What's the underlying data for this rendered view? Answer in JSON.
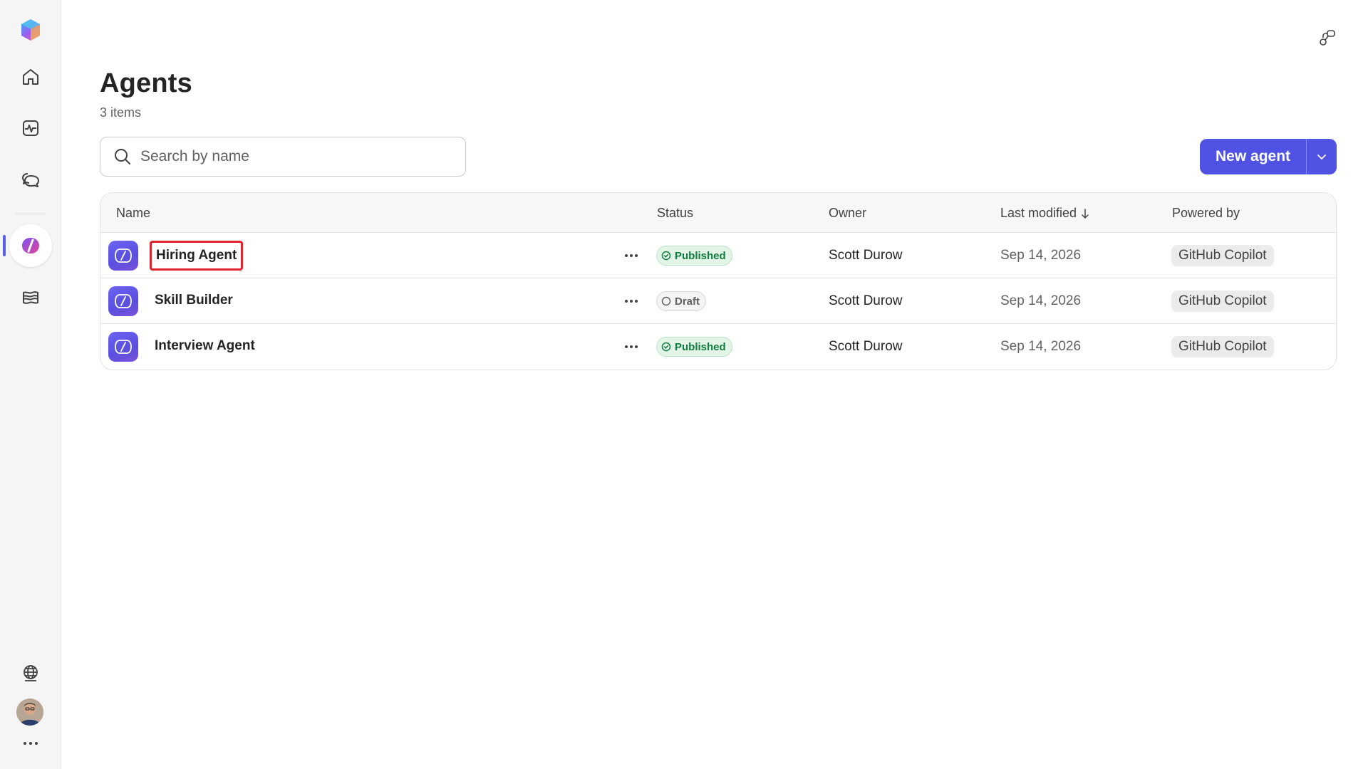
{
  "rail": {
    "items": [
      {
        "name": "home",
        "icon": "home-icon"
      },
      {
        "name": "activity",
        "icon": "activity-icon"
      },
      {
        "name": "chat",
        "icon": "chat-icon"
      },
      {
        "name": "agents",
        "icon": "agent-studio-icon",
        "active": true
      },
      {
        "name": "library",
        "icon": "library-icon"
      }
    ],
    "bottom": [
      {
        "name": "globe",
        "icon": "globe-icon"
      },
      {
        "name": "avatar",
        "icon": "avatar"
      },
      {
        "name": "more",
        "icon": "more-horizontal-icon"
      }
    ]
  },
  "page": {
    "title": "Agents",
    "count": "3 items"
  },
  "search": {
    "placeholder": "Search by name"
  },
  "toolbar": {
    "new_agent_label": "New agent"
  },
  "table": {
    "columns": {
      "name": "Name",
      "status": "Status",
      "owner": "Owner",
      "modified": "Last modified",
      "powered": "Powered by"
    },
    "rows": [
      {
        "name": "Hiring Agent",
        "status": "Published",
        "owner": "Scott Durow",
        "modified": "Sep 14, 2026",
        "powered": "GitHub Copilot"
      },
      {
        "name": "Skill Builder",
        "status": "Draft",
        "owner": "Scott Durow",
        "modified": "Sep 14, 2026",
        "powered": "GitHub Copilot"
      },
      {
        "name": "Interview Agent",
        "status": "Published",
        "owner": "Scott Durow",
        "modified": "Sep 14, 2026",
        "powered": "GitHub Copilot"
      }
    ]
  },
  "colors": {
    "accent": "#4f52e3",
    "published": "#107c41",
    "highlight": "#e0232c"
  }
}
